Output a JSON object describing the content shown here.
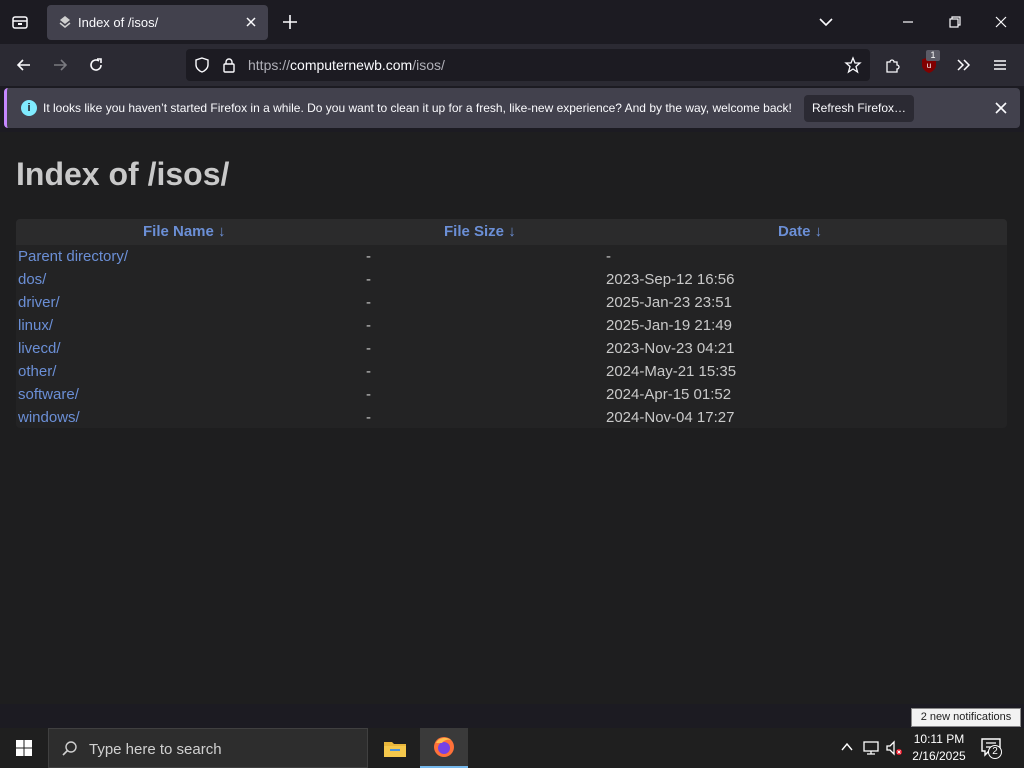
{
  "browser": {
    "tab": {
      "title": "Index of /isos/"
    },
    "url": {
      "scheme": "https://",
      "host": "computernewb.com",
      "path": "/isos/"
    },
    "extension_badge": "1"
  },
  "notification": {
    "message": "It looks like you haven’t started Firefox in a while. Do you want to clean it up for a fresh, like-new experience? And by the way, welcome back!",
    "button": "Refresh Firefox…"
  },
  "page": {
    "title": "Index of /isos/",
    "columns": {
      "name": "File Name  ↓",
      "size": "File Size  ↓",
      "date": "Date  ↓"
    },
    "rows": [
      {
        "name": "Parent directory/",
        "size": "-",
        "date": "-"
      },
      {
        "name": "dos/",
        "size": "-",
        "date": "2023-Sep-12 16:56"
      },
      {
        "name": "driver/",
        "size": "-",
        "date": "2025-Jan-23 23:51"
      },
      {
        "name": "linux/",
        "size": "-",
        "date": "2025-Jan-19 21:49"
      },
      {
        "name": "livecd/",
        "size": "-",
        "date": "2023-Nov-23 04:21"
      },
      {
        "name": "other/",
        "size": "-",
        "date": "2024-May-21 15:35"
      },
      {
        "name": "software/",
        "size": "-",
        "date": "2024-Apr-15 01:52"
      },
      {
        "name": "windows/",
        "size": "-",
        "date": "2024-Nov-04 17:27"
      }
    ]
  },
  "taskbar": {
    "search_placeholder": "Type here to search",
    "time": "10:11 PM",
    "date": "2/16/2025",
    "notifications_tip": "2 new notifications",
    "notification_count": "2"
  }
}
